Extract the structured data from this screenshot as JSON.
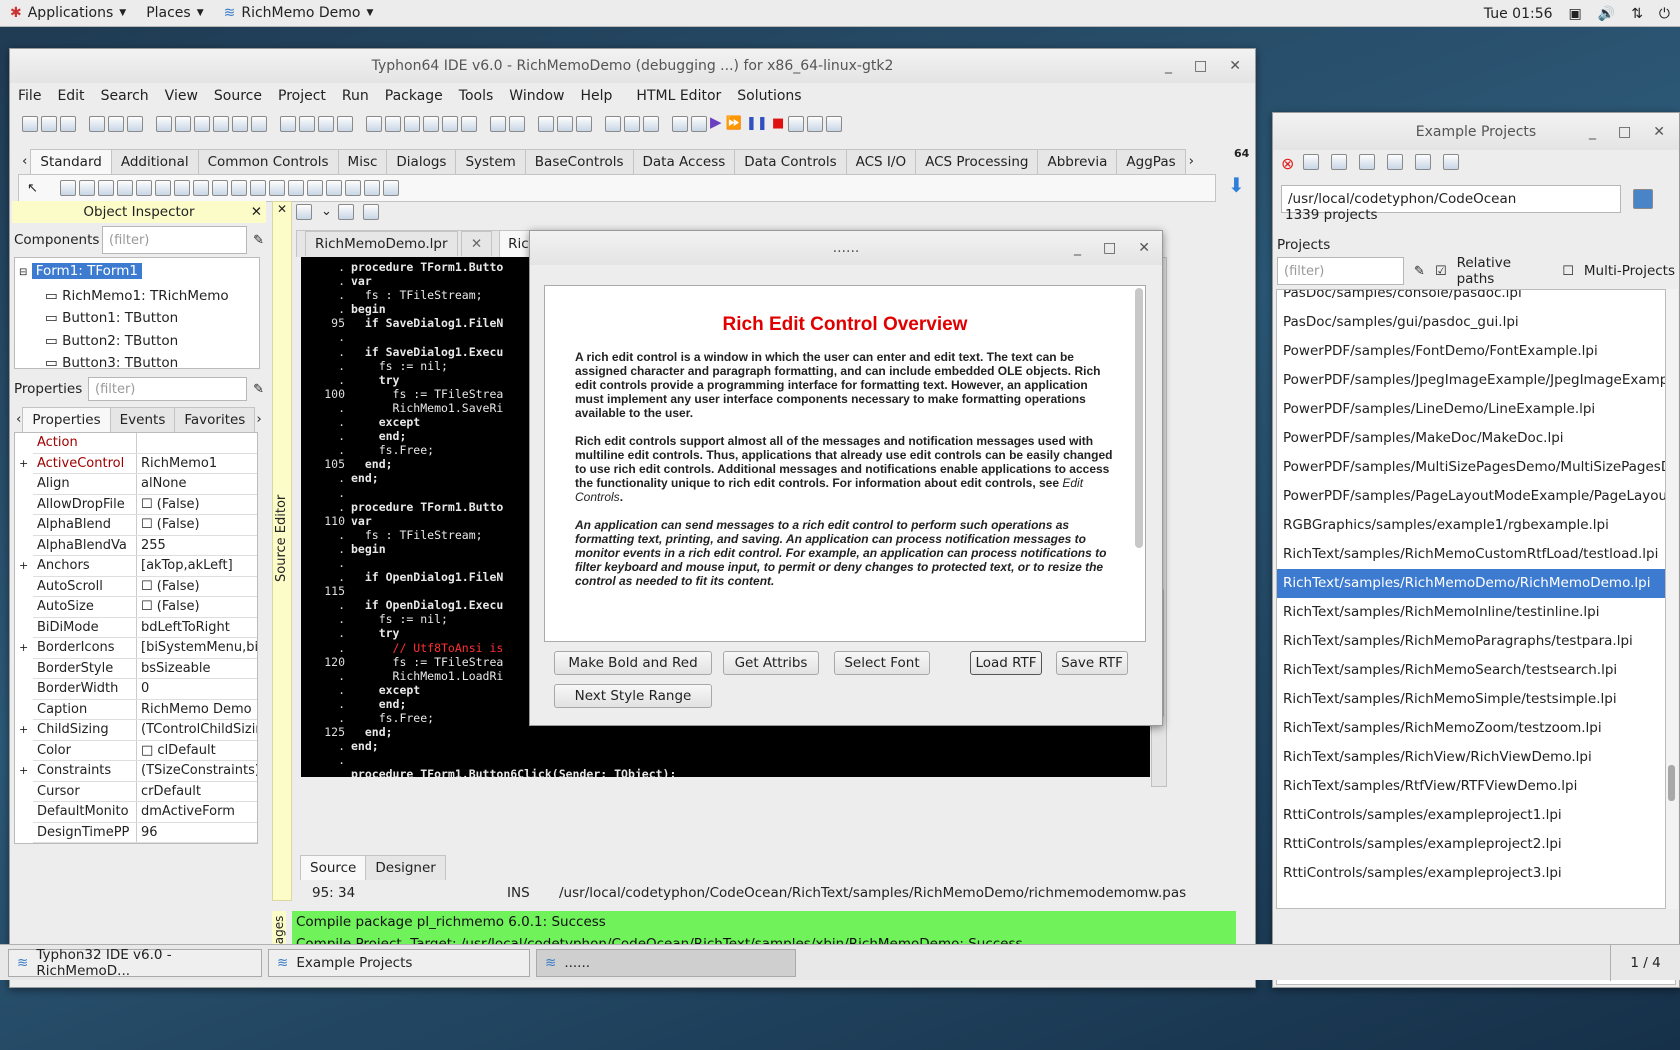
{
  "topbar": {
    "applications": "Applications",
    "places": "Places",
    "app": "RichMemo Demo",
    "clock": "Tue 01:56"
  },
  "ide": {
    "title": "Typhon64 IDE v6.0 - RichMemoDemo (debugging ...) for x86_64-linux-gtk2",
    "menu": [
      "File",
      "Edit",
      "Search",
      "View",
      "Source",
      "Project",
      "Run",
      "Package",
      "Tools",
      "Window",
      "Help",
      "HTML Editor",
      "Solutions"
    ],
    "palette_tabs": [
      "Standard",
      "Additional",
      "Common Controls",
      "Misc",
      "Dialogs",
      "System",
      "BaseControls",
      "Data Access",
      "Data Controls",
      "ACS I/O",
      "ACS Processing",
      "Abbrevia",
      "AggPas"
    ],
    "palette_badge": "64"
  },
  "oi": {
    "title": "Object Inspector",
    "components_label": "Components",
    "filter": "(filter)",
    "tree": [
      "Form1: TForm1",
      "RichMemo1: TRichMemo",
      "Button1: TButton",
      "Button2: TButton",
      "Button3: TButton"
    ],
    "properties_label": "Properties",
    "tabs": [
      "Properties",
      "Events",
      "Favorites"
    ],
    "rows": [
      [
        "Action",
        ""
      ],
      [
        "ActiveControl",
        "RichMemo1"
      ],
      [
        "Align",
        "alNone"
      ],
      [
        "AllowDropFile",
        "(False)"
      ],
      [
        "AlphaBlend",
        "(False)"
      ],
      [
        "AlphaBlendVa",
        "255"
      ],
      [
        "Anchors",
        "[akTop,akLeft]"
      ],
      [
        "AutoScroll",
        "(False)"
      ],
      [
        "AutoSize",
        "(False)"
      ],
      [
        "BiDiMode",
        "bdLeftToRight"
      ],
      [
        "BorderIcons",
        "[biSystemMenu,biMir"
      ],
      [
        "BorderStyle",
        "bsSizeable"
      ],
      [
        "BorderWidth",
        "0"
      ],
      [
        "Caption",
        "RichMemo Demo"
      ],
      [
        "ChildSizing",
        "(TControlChildSizing)"
      ],
      [
        "Color",
        "clDefault"
      ],
      [
        "Constraints",
        "(TSizeConstraints)"
      ],
      [
        "Cursor",
        "crDefault"
      ],
      [
        "DefaultMonito",
        "dmActiveForm"
      ],
      [
        "DesignTimePP",
        "96"
      ]
    ]
  },
  "editor": {
    "side_label": "Source Editor",
    "tabs": [
      "RichMemoDemo.lpr",
      "RichMe"
    ],
    "bottom_tabs": [
      "Source",
      "Designer"
    ],
    "status": {
      "pos": "95: 34",
      "mode": "INS",
      "file": "/usr/local/codetyphon/CodeOcean/RichText/samples/RichMemoDemo/richmemodemomw.pas"
    },
    "gutter": [
      ".",
      ".",
      ".",
      ".",
      "95",
      ".",
      ".",
      ".",
      ".",
      "100",
      ".",
      ".",
      ".",
      ".",
      "105",
      ".",
      ".",
      ".",
      "110",
      ".",
      ".",
      ".",
      ".",
      "115",
      ".",
      ".",
      ".",
      ".",
      "120",
      ".",
      ".",
      ".",
      ".",
      "125",
      ".",
      "."
    ],
    "code": [
      "procedure TForm1.Butto",
      "var",
      "  fs : TFileStream;",
      "begin",
      "  if SaveDialog1.FileN",
      "",
      "  if SaveDialog1.Execu",
      "    fs := nil;",
      "    try",
      "      fs := TFileStrea",
      "      RichMemo1.SaveRi",
      "    except",
      "    end;",
      "    fs.Free;",
      "  end;",
      "end;",
      "",
      "procedure TForm1.Butto",
      "var",
      "  fs : TFileStream;",
      "begin",
      "",
      "  if OpenDialog1.FileN",
      "",
      "  if OpenDialog1.Execu",
      "    fs := nil;",
      "    try",
      "      // Utf8ToAnsi is",
      "      fs := TFileStrea",
      "      RichMemo1.LoadRi",
      "    except",
      "    end;",
      "    fs.Free;",
      "  end;",
      "end;",
      "",
      "procedure TForm1.Button6Click(Sender: TObject);"
    ]
  },
  "messages": {
    "label": "Messages",
    "lines": [
      "Compile package pl_richmemo 6.0.1: Success",
      "Compile Project, Target: /usr/local/codetyphon/CodeOcean/RichText/samples/xbin/RichMemoDemo: Success"
    ]
  },
  "dialog": {
    "title": "......",
    "heading": "Rich Edit Control Overview",
    "p1": "A rich edit control is a window in which the user can enter and edit text. The text can be assigned character and paragraph formatting, and can include embedded OLE objects. Rich edit controls provide a programming interface for formatting text. However, an application must implement any user interface components necessary to make formatting operations available to the user.",
    "p2a": "Rich edit controls support almost all of the messages and notification messages used with multiline edit controls. Thus, applications that already use edit controls can be easily changed to use rich edit controls. Additional messages and notifications enable applications to access the functionality unique to rich edit controls. For information about edit controls, see ",
    "p2b": "Edit Controls",
    "p3": "An application can send messages to a rich edit control to perform such operations as formatting text, printing, and saving. An application can process notification messages to monitor events in a rich edit control. For example, an application can process notifications to filter keyboard and mouse input, to permit or deny changes to protected text, or to resize the control as needed to fit its content.",
    "buttons": {
      "bold": "Make Bold and Red",
      "attribs": "Get Attribs",
      "font": "Select Font",
      "load": "Load RTF",
      "save": "Save RTF",
      "next": "Next Style Range"
    }
  },
  "projects": {
    "title": "Example Projects",
    "path": "/usr/local/codetyphon/CodeOcean",
    "count": "1339 projects",
    "label": "Projects",
    "filter": "(filter)",
    "relative": "Relative paths",
    "multi": "Multi-Projects",
    "items": [
      "PasDoc/samples/console/pasdoc.lpi",
      "PasDoc/samples/gui/pasdoc_gui.lpi",
      "PowerPDF/samples/FontDemo/FontExample.lpi",
      "PowerPDF/samples/JpegImageExample/JpegImageExample",
      "PowerPDF/samples/LineDemo/LineExample.lpi",
      "PowerPDF/samples/MakeDoc/MakeDoc.lpi",
      "PowerPDF/samples/MultiSizePagesDemo/MultiSizePagesD",
      "PowerPDF/samples/PageLayoutModeExample/PageLayoutM",
      "RGBGraphics/samples/example1/rgbexample.lpi",
      "RichText/samples/RichMemoCustomRtfLoad/testload.lpi",
      "RichText/samples/RichMemoDemo/RichMemoDemo.lpi",
      "RichText/samples/RichMemoInline/testinline.lpi",
      "RichText/samples/RichMemoParagraphs/testpara.lpi",
      "RichText/samples/RichMemoSearch/testsearch.lpi",
      "RichText/samples/RichMemoSimple/testsimple.lpi",
      "RichText/samples/RichMemoZoom/testzoom.lpi",
      "RichText/samples/RichView/RichViewDemo.lpi",
      "RichText/samples/RtfView/RTFViewDemo.lpi",
      "RttiControls/samples/exampleproject1.lpi",
      "RttiControls/samples/exampleproject2.lpi",
      "RttiControls/samples/exampleproject3.lpi"
    ],
    "selected_index": 10
  },
  "taskbar": {
    "t1": "Typhon32 IDE v6.0 - RichMemoD...",
    "t2": "Example Projects",
    "t3": "......",
    "pager": "1 / 4"
  }
}
